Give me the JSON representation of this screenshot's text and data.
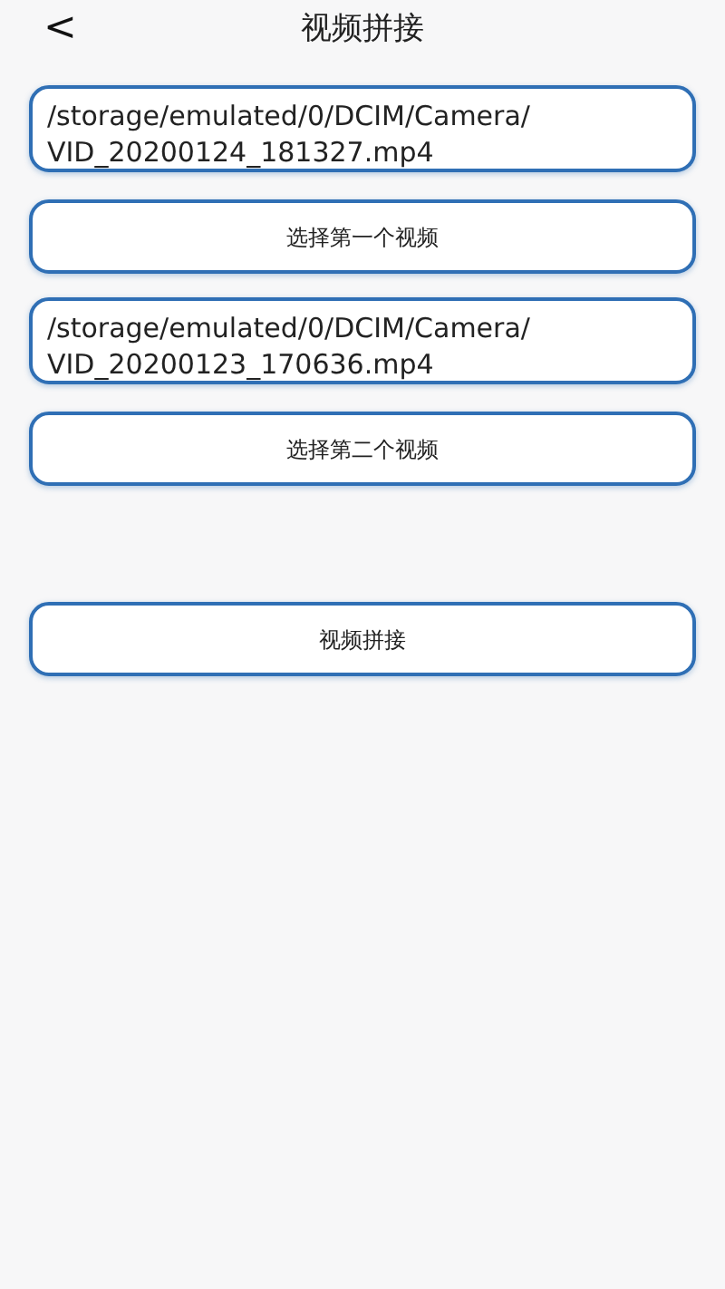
{
  "header": {
    "back_icon": "<",
    "title": "视频拼接"
  },
  "videos": [
    {
      "path": "/storage/emulated/0/DCIM/Camera/\nVID_20200124_181327.mp4",
      "button": "选择第一个视频"
    },
    {
      "path": "/storage/emulated/0/DCIM/Camera/\nVID_20200123_170636.mp4",
      "button": "选择第二个视频"
    }
  ],
  "action_button": "视频拼接"
}
